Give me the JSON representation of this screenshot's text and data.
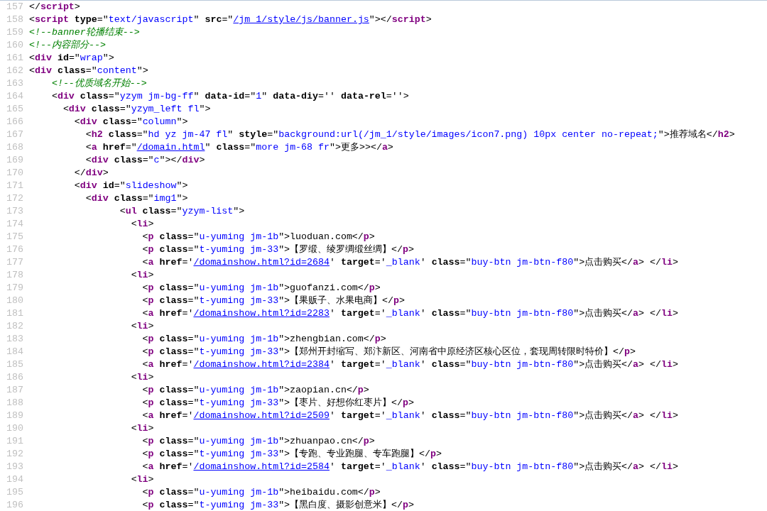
{
  "source_view": {
    "lines": [
      {
        "number": "157",
        "tokens": [
          {
            "kind": "punct",
            "text": "</"
          },
          {
            "kind": "tag",
            "text": "script"
          },
          {
            "kind": "punct",
            "text": ">"
          }
        ]
      },
      {
        "number": "158",
        "tokens": [
          {
            "kind": "punct",
            "text": "<"
          },
          {
            "kind": "tag",
            "text": "script"
          },
          {
            "kind": "attr",
            "text": " type"
          },
          {
            "kind": "punct",
            "text": "=\""
          },
          {
            "kind": "value",
            "text": "text/javascript"
          },
          {
            "kind": "punct",
            "text": "\" "
          },
          {
            "kind": "attr",
            "text": "src"
          },
          {
            "kind": "punct",
            "text": "=\""
          },
          {
            "kind": "link",
            "text": "/jm_1/style/js/banner.js"
          },
          {
            "kind": "punct",
            "text": "\"></"
          },
          {
            "kind": "tag",
            "text": "script"
          },
          {
            "kind": "punct",
            "text": ">"
          }
        ]
      },
      {
        "number": "159",
        "tokens": [
          {
            "kind": "comment",
            "text": "<!--banner轮播结束-->"
          }
        ]
      },
      {
        "number": "160",
        "tokens": [
          {
            "kind": "comment",
            "text": "<!--内容部分-->"
          }
        ]
      },
      {
        "number": "161",
        "tokens": [
          {
            "kind": "punct",
            "text": "<"
          },
          {
            "kind": "tag",
            "text": "div"
          },
          {
            "kind": "attr",
            "text": " id"
          },
          {
            "kind": "punct",
            "text": "=\""
          },
          {
            "kind": "value",
            "text": "wrap"
          },
          {
            "kind": "punct",
            "text": "\">"
          }
        ]
      },
      {
        "number": "162",
        "tokens": [
          {
            "kind": "punct",
            "text": "<"
          },
          {
            "kind": "tag",
            "text": "div"
          },
          {
            "kind": "attr",
            "text": " class"
          },
          {
            "kind": "punct",
            "text": "=\""
          },
          {
            "kind": "value",
            "text": "content"
          },
          {
            "kind": "punct",
            "text": "\">"
          }
        ]
      },
      {
        "number": "163",
        "tokens": [
          {
            "kind": "comment",
            "text": "    <!--优质域名开始-->"
          }
        ]
      },
      {
        "number": "164",
        "tokens": [
          {
            "kind": "punct",
            "text": "    <"
          },
          {
            "kind": "tag",
            "text": "div"
          },
          {
            "kind": "attr",
            "text": " class"
          },
          {
            "kind": "punct",
            "text": "=\""
          },
          {
            "kind": "value",
            "text": "yzym jm-bg-ff"
          },
          {
            "kind": "punct",
            "text": "\" "
          },
          {
            "kind": "attr",
            "text": "data-id"
          },
          {
            "kind": "punct",
            "text": "=\""
          },
          {
            "kind": "value",
            "text": "1"
          },
          {
            "kind": "punct",
            "text": "\" "
          },
          {
            "kind": "attr",
            "text": "data-diy"
          },
          {
            "kind": "punct",
            "text": "='' "
          },
          {
            "kind": "attr",
            "text": "data-rel"
          },
          {
            "kind": "punct",
            "text": "=''>"
          }
        ]
      },
      {
        "number": "165",
        "tokens": [
          {
            "kind": "punct",
            "text": "      <"
          },
          {
            "kind": "tag",
            "text": "div"
          },
          {
            "kind": "attr",
            "text": " class"
          },
          {
            "kind": "punct",
            "text": "=\""
          },
          {
            "kind": "value",
            "text": "yzym_left fl"
          },
          {
            "kind": "punct",
            "text": "\">"
          }
        ]
      },
      {
        "number": "166",
        "tokens": [
          {
            "kind": "punct",
            "text": "        <"
          },
          {
            "kind": "tag",
            "text": "div"
          },
          {
            "kind": "attr",
            "text": " class"
          },
          {
            "kind": "punct",
            "text": "=\""
          },
          {
            "kind": "value",
            "text": "column"
          },
          {
            "kind": "punct",
            "text": "\">"
          }
        ]
      },
      {
        "number": "167",
        "tokens": [
          {
            "kind": "punct",
            "text": "          <"
          },
          {
            "kind": "tag",
            "text": "h2"
          },
          {
            "kind": "attr",
            "text": " class"
          },
          {
            "kind": "punct",
            "text": "=\""
          },
          {
            "kind": "value",
            "text": "hd yz jm-47 fl"
          },
          {
            "kind": "punct",
            "text": "\" "
          },
          {
            "kind": "attr",
            "text": "style"
          },
          {
            "kind": "punct",
            "text": "=\""
          },
          {
            "kind": "value",
            "text": "background:url(/jm_1/style/images/icon7.png) 10px center no-repeat;"
          },
          {
            "kind": "punct",
            "text": "\">推荐域名</"
          },
          {
            "kind": "tag",
            "text": "h2"
          },
          {
            "kind": "punct",
            "text": ">"
          }
        ]
      },
      {
        "number": "168",
        "tokens": [
          {
            "kind": "punct",
            "text": "          <"
          },
          {
            "kind": "tag",
            "text": "a"
          },
          {
            "kind": "attr",
            "text": " href"
          },
          {
            "kind": "punct",
            "text": "=\""
          },
          {
            "kind": "link",
            "text": "/domain.html"
          },
          {
            "kind": "punct",
            "text": "\" "
          },
          {
            "kind": "attr",
            "text": "class"
          },
          {
            "kind": "punct",
            "text": "=\""
          },
          {
            "kind": "value",
            "text": "more jm-68 fr"
          },
          {
            "kind": "punct",
            "text": "\">更多>></"
          },
          {
            "kind": "tag",
            "text": "a"
          },
          {
            "kind": "punct",
            "text": ">"
          }
        ]
      },
      {
        "number": "169",
        "tokens": [
          {
            "kind": "punct",
            "text": "          <"
          },
          {
            "kind": "tag",
            "text": "div"
          },
          {
            "kind": "attr",
            "text": " class"
          },
          {
            "kind": "punct",
            "text": "=\""
          },
          {
            "kind": "value",
            "text": "c"
          },
          {
            "kind": "punct",
            "text": "\"></"
          },
          {
            "kind": "tag",
            "text": "div"
          },
          {
            "kind": "punct",
            "text": ">"
          }
        ]
      },
      {
        "number": "170",
        "tokens": [
          {
            "kind": "punct",
            "text": "        </"
          },
          {
            "kind": "tag",
            "text": "div"
          },
          {
            "kind": "punct",
            "text": ">"
          }
        ]
      },
      {
        "number": "171",
        "tokens": [
          {
            "kind": "punct",
            "text": "        <"
          },
          {
            "kind": "tag",
            "text": "div"
          },
          {
            "kind": "attr",
            "text": " id"
          },
          {
            "kind": "punct",
            "text": "=\""
          },
          {
            "kind": "value",
            "text": "slideshow"
          },
          {
            "kind": "punct",
            "text": "\">"
          }
        ]
      },
      {
        "number": "172",
        "tokens": [
          {
            "kind": "punct",
            "text": "          <"
          },
          {
            "kind": "tag",
            "text": "div"
          },
          {
            "kind": "attr",
            "text": " class"
          },
          {
            "kind": "punct",
            "text": "=\""
          },
          {
            "kind": "value",
            "text": "img1"
          },
          {
            "kind": "punct",
            "text": "\">"
          }
        ]
      },
      {
        "number": "173",
        "tokens": [
          {
            "kind": "punct",
            "text": "                <"
          },
          {
            "kind": "tag",
            "text": "ul"
          },
          {
            "kind": "attr",
            "text": " class"
          },
          {
            "kind": "punct",
            "text": "=\""
          },
          {
            "kind": "value",
            "text": "yzym-list"
          },
          {
            "kind": "punct",
            "text": "\">"
          }
        ]
      },
      {
        "number": "174",
        "tokens": [
          {
            "kind": "punct",
            "text": "                  <"
          },
          {
            "kind": "tag",
            "text": "li"
          },
          {
            "kind": "punct",
            "text": ">"
          }
        ]
      },
      {
        "number": "175",
        "tokens": [
          {
            "kind": "punct",
            "text": "                    <"
          },
          {
            "kind": "tag",
            "text": "p"
          },
          {
            "kind": "attr",
            "text": " class"
          },
          {
            "kind": "punct",
            "text": "=\""
          },
          {
            "kind": "value",
            "text": "u-yuming jm-1b"
          },
          {
            "kind": "punct",
            "text": "\">luoduan.com</"
          },
          {
            "kind": "tag",
            "text": "p"
          },
          {
            "kind": "punct",
            "text": ">"
          }
        ]
      },
      {
        "number": "176",
        "tokens": [
          {
            "kind": "punct",
            "text": "                    <"
          },
          {
            "kind": "tag",
            "text": "p"
          },
          {
            "kind": "attr",
            "text": " class"
          },
          {
            "kind": "punct",
            "text": "=\""
          },
          {
            "kind": "value",
            "text": "t-yuming jm-33"
          },
          {
            "kind": "punct",
            "text": "\">【罗缎、绫罗绸缎丝绸】</"
          },
          {
            "kind": "tag",
            "text": "p"
          },
          {
            "kind": "punct",
            "text": ">"
          }
        ]
      },
      {
        "number": "177",
        "tokens": [
          {
            "kind": "punct",
            "text": "                    <"
          },
          {
            "kind": "tag",
            "text": "a"
          },
          {
            "kind": "attr",
            "text": " href"
          },
          {
            "kind": "punct",
            "text": "='"
          },
          {
            "kind": "link",
            "text": "/domainshow.html?id=2684"
          },
          {
            "kind": "punct",
            "text": "' "
          },
          {
            "kind": "attr",
            "text": "target"
          },
          {
            "kind": "punct",
            "text": "='"
          },
          {
            "kind": "value",
            "text": "_blank"
          },
          {
            "kind": "punct",
            "text": "' "
          },
          {
            "kind": "attr",
            "text": "class"
          },
          {
            "kind": "punct",
            "text": "=\""
          },
          {
            "kind": "value",
            "text": "buy-btn jm-btn-f80"
          },
          {
            "kind": "punct",
            "text": "\">点击购买</"
          },
          {
            "kind": "tag",
            "text": "a"
          },
          {
            "kind": "punct",
            "text": "> </"
          },
          {
            "kind": "tag",
            "text": "li"
          },
          {
            "kind": "punct",
            "text": ">"
          }
        ]
      },
      {
        "number": "178",
        "tokens": [
          {
            "kind": "punct",
            "text": "                  <"
          },
          {
            "kind": "tag",
            "text": "li"
          },
          {
            "kind": "punct",
            "text": ">"
          }
        ]
      },
      {
        "number": "179",
        "tokens": [
          {
            "kind": "punct",
            "text": "                    <"
          },
          {
            "kind": "tag",
            "text": "p"
          },
          {
            "kind": "attr",
            "text": " class"
          },
          {
            "kind": "punct",
            "text": "=\""
          },
          {
            "kind": "value",
            "text": "u-yuming jm-1b"
          },
          {
            "kind": "punct",
            "text": "\">guofanzi.com</"
          },
          {
            "kind": "tag",
            "text": "p"
          },
          {
            "kind": "punct",
            "text": ">"
          }
        ]
      },
      {
        "number": "180",
        "tokens": [
          {
            "kind": "punct",
            "text": "                    <"
          },
          {
            "kind": "tag",
            "text": "p"
          },
          {
            "kind": "attr",
            "text": " class"
          },
          {
            "kind": "punct",
            "text": "=\""
          },
          {
            "kind": "value",
            "text": "t-yuming jm-33"
          },
          {
            "kind": "punct",
            "text": "\">【果贩子、水果电商】</"
          },
          {
            "kind": "tag",
            "text": "p"
          },
          {
            "kind": "punct",
            "text": ">"
          }
        ]
      },
      {
        "number": "181",
        "tokens": [
          {
            "kind": "punct",
            "text": "                    <"
          },
          {
            "kind": "tag",
            "text": "a"
          },
          {
            "kind": "attr",
            "text": " href"
          },
          {
            "kind": "punct",
            "text": "='"
          },
          {
            "kind": "link",
            "text": "/domainshow.html?id=2283"
          },
          {
            "kind": "punct",
            "text": "' "
          },
          {
            "kind": "attr",
            "text": "target"
          },
          {
            "kind": "punct",
            "text": "='"
          },
          {
            "kind": "value",
            "text": "_blank"
          },
          {
            "kind": "punct",
            "text": "' "
          },
          {
            "kind": "attr",
            "text": "class"
          },
          {
            "kind": "punct",
            "text": "=\""
          },
          {
            "kind": "value",
            "text": "buy-btn jm-btn-f80"
          },
          {
            "kind": "punct",
            "text": "\">点击购买</"
          },
          {
            "kind": "tag",
            "text": "a"
          },
          {
            "kind": "punct",
            "text": "> </"
          },
          {
            "kind": "tag",
            "text": "li"
          },
          {
            "kind": "punct",
            "text": ">"
          }
        ]
      },
      {
        "number": "182",
        "tokens": [
          {
            "kind": "punct",
            "text": "                  <"
          },
          {
            "kind": "tag",
            "text": "li"
          },
          {
            "kind": "punct",
            "text": ">"
          }
        ]
      },
      {
        "number": "183",
        "tokens": [
          {
            "kind": "punct",
            "text": "                    <"
          },
          {
            "kind": "tag",
            "text": "p"
          },
          {
            "kind": "attr",
            "text": " class"
          },
          {
            "kind": "punct",
            "text": "=\""
          },
          {
            "kind": "value",
            "text": "u-yuming jm-1b"
          },
          {
            "kind": "punct",
            "text": "\">zhengbian.com</"
          },
          {
            "kind": "tag",
            "text": "p"
          },
          {
            "kind": "punct",
            "text": ">"
          }
        ]
      },
      {
        "number": "184",
        "tokens": [
          {
            "kind": "punct",
            "text": "                    <"
          },
          {
            "kind": "tag",
            "text": "p"
          },
          {
            "kind": "attr",
            "text": " class"
          },
          {
            "kind": "punct",
            "text": "=\""
          },
          {
            "kind": "value",
            "text": "t-yuming jm-33"
          },
          {
            "kind": "punct",
            "text": "\">【郑州开封缩写、郑汴新区、河南省中原经济区核心区位，套现周转限时特价】</"
          },
          {
            "kind": "tag",
            "text": "p"
          },
          {
            "kind": "punct",
            "text": ">"
          }
        ]
      },
      {
        "number": "185",
        "tokens": [
          {
            "kind": "punct",
            "text": "                    <"
          },
          {
            "kind": "tag",
            "text": "a"
          },
          {
            "kind": "attr",
            "text": " href"
          },
          {
            "kind": "punct",
            "text": "='"
          },
          {
            "kind": "link",
            "text": "/domainshow.html?id=2384"
          },
          {
            "kind": "punct",
            "text": "' "
          },
          {
            "kind": "attr",
            "text": "target"
          },
          {
            "kind": "punct",
            "text": "='"
          },
          {
            "kind": "value",
            "text": "_blank"
          },
          {
            "kind": "punct",
            "text": "' "
          },
          {
            "kind": "attr",
            "text": "class"
          },
          {
            "kind": "punct",
            "text": "=\""
          },
          {
            "kind": "value",
            "text": "buy-btn jm-btn-f80"
          },
          {
            "kind": "punct",
            "text": "\">点击购买</"
          },
          {
            "kind": "tag",
            "text": "a"
          },
          {
            "kind": "punct",
            "text": "> </"
          },
          {
            "kind": "tag",
            "text": "li"
          },
          {
            "kind": "punct",
            "text": ">"
          }
        ]
      },
      {
        "number": "186",
        "tokens": [
          {
            "kind": "punct",
            "text": "                  <"
          },
          {
            "kind": "tag",
            "text": "li"
          },
          {
            "kind": "punct",
            "text": ">"
          }
        ]
      },
      {
        "number": "187",
        "tokens": [
          {
            "kind": "punct",
            "text": "                    <"
          },
          {
            "kind": "tag",
            "text": "p"
          },
          {
            "kind": "attr",
            "text": " class"
          },
          {
            "kind": "punct",
            "text": "=\""
          },
          {
            "kind": "value",
            "text": "u-yuming jm-1b"
          },
          {
            "kind": "punct",
            "text": "\">zaopian.cn</"
          },
          {
            "kind": "tag",
            "text": "p"
          },
          {
            "kind": "punct",
            "text": ">"
          }
        ]
      },
      {
        "number": "188",
        "tokens": [
          {
            "kind": "punct",
            "text": "                    <"
          },
          {
            "kind": "tag",
            "text": "p"
          },
          {
            "kind": "attr",
            "text": " class"
          },
          {
            "kind": "punct",
            "text": "=\""
          },
          {
            "kind": "value",
            "text": "t-yuming jm-33"
          },
          {
            "kind": "punct",
            "text": "\">【枣片、好想你红枣片】</"
          },
          {
            "kind": "tag",
            "text": "p"
          },
          {
            "kind": "punct",
            "text": ">"
          }
        ]
      },
      {
        "number": "189",
        "tokens": [
          {
            "kind": "punct",
            "text": "                    <"
          },
          {
            "kind": "tag",
            "text": "a"
          },
          {
            "kind": "attr",
            "text": " href"
          },
          {
            "kind": "punct",
            "text": "='"
          },
          {
            "kind": "link",
            "text": "/domainshow.html?id=2509"
          },
          {
            "kind": "punct",
            "text": "' "
          },
          {
            "kind": "attr",
            "text": "target"
          },
          {
            "kind": "punct",
            "text": "='"
          },
          {
            "kind": "value",
            "text": "_blank"
          },
          {
            "kind": "punct",
            "text": "' "
          },
          {
            "kind": "attr",
            "text": "class"
          },
          {
            "kind": "punct",
            "text": "=\""
          },
          {
            "kind": "value",
            "text": "buy-btn jm-btn-f80"
          },
          {
            "kind": "punct",
            "text": "\">点击购买</"
          },
          {
            "kind": "tag",
            "text": "a"
          },
          {
            "kind": "punct",
            "text": "> </"
          },
          {
            "kind": "tag",
            "text": "li"
          },
          {
            "kind": "punct",
            "text": ">"
          }
        ]
      },
      {
        "number": "190",
        "tokens": [
          {
            "kind": "punct",
            "text": "                  <"
          },
          {
            "kind": "tag",
            "text": "li"
          },
          {
            "kind": "punct",
            "text": ">"
          }
        ]
      },
      {
        "number": "191",
        "tokens": [
          {
            "kind": "punct",
            "text": "                    <"
          },
          {
            "kind": "tag",
            "text": "p"
          },
          {
            "kind": "attr",
            "text": " class"
          },
          {
            "kind": "punct",
            "text": "=\""
          },
          {
            "kind": "value",
            "text": "u-yuming jm-1b"
          },
          {
            "kind": "punct",
            "text": "\">zhuanpao.cn</"
          },
          {
            "kind": "tag",
            "text": "p"
          },
          {
            "kind": "punct",
            "text": ">"
          }
        ]
      },
      {
        "number": "192",
        "tokens": [
          {
            "kind": "punct",
            "text": "                    <"
          },
          {
            "kind": "tag",
            "text": "p"
          },
          {
            "kind": "attr",
            "text": " class"
          },
          {
            "kind": "punct",
            "text": "=\""
          },
          {
            "kind": "value",
            "text": "t-yuming jm-33"
          },
          {
            "kind": "punct",
            "text": "\">【专跑、专业跑腿、专车跑腿】</"
          },
          {
            "kind": "tag",
            "text": "p"
          },
          {
            "kind": "punct",
            "text": ">"
          }
        ]
      },
      {
        "number": "193",
        "tokens": [
          {
            "kind": "punct",
            "text": "                    <"
          },
          {
            "kind": "tag",
            "text": "a"
          },
          {
            "kind": "attr",
            "text": " href"
          },
          {
            "kind": "punct",
            "text": "='"
          },
          {
            "kind": "link",
            "text": "/domainshow.html?id=2584"
          },
          {
            "kind": "punct",
            "text": "' "
          },
          {
            "kind": "attr",
            "text": "target"
          },
          {
            "kind": "punct",
            "text": "='"
          },
          {
            "kind": "value",
            "text": "_blank"
          },
          {
            "kind": "punct",
            "text": "' "
          },
          {
            "kind": "attr",
            "text": "class"
          },
          {
            "kind": "punct",
            "text": "=\""
          },
          {
            "kind": "value",
            "text": "buy-btn jm-btn-f80"
          },
          {
            "kind": "punct",
            "text": "\">点击购买</"
          },
          {
            "kind": "tag",
            "text": "a"
          },
          {
            "kind": "punct",
            "text": "> </"
          },
          {
            "kind": "tag",
            "text": "li"
          },
          {
            "kind": "punct",
            "text": ">"
          }
        ]
      },
      {
        "number": "194",
        "tokens": [
          {
            "kind": "punct",
            "text": "                  <"
          },
          {
            "kind": "tag",
            "text": "li"
          },
          {
            "kind": "punct",
            "text": ">"
          }
        ]
      },
      {
        "number": "195",
        "tokens": [
          {
            "kind": "punct",
            "text": "                    <"
          },
          {
            "kind": "tag",
            "text": "p"
          },
          {
            "kind": "attr",
            "text": " class"
          },
          {
            "kind": "punct",
            "text": "=\""
          },
          {
            "kind": "value",
            "text": "u-yuming jm-1b"
          },
          {
            "kind": "punct",
            "text": "\">heibaidu.com</"
          },
          {
            "kind": "tag",
            "text": "p"
          },
          {
            "kind": "punct",
            "text": ">"
          }
        ]
      },
      {
        "number": "196",
        "tokens": [
          {
            "kind": "punct",
            "text": "                    <"
          },
          {
            "kind": "tag",
            "text": "p"
          },
          {
            "kind": "attr",
            "text": " class"
          },
          {
            "kind": "punct",
            "text": "=\""
          },
          {
            "kind": "value",
            "text": "t-yuming jm-33"
          },
          {
            "kind": "punct",
            "text": "\">【黑白度、摄影创意米】</"
          },
          {
            "kind": "tag",
            "text": "p"
          },
          {
            "kind": "punct",
            "text": ">"
          }
        ]
      }
    ]
  }
}
